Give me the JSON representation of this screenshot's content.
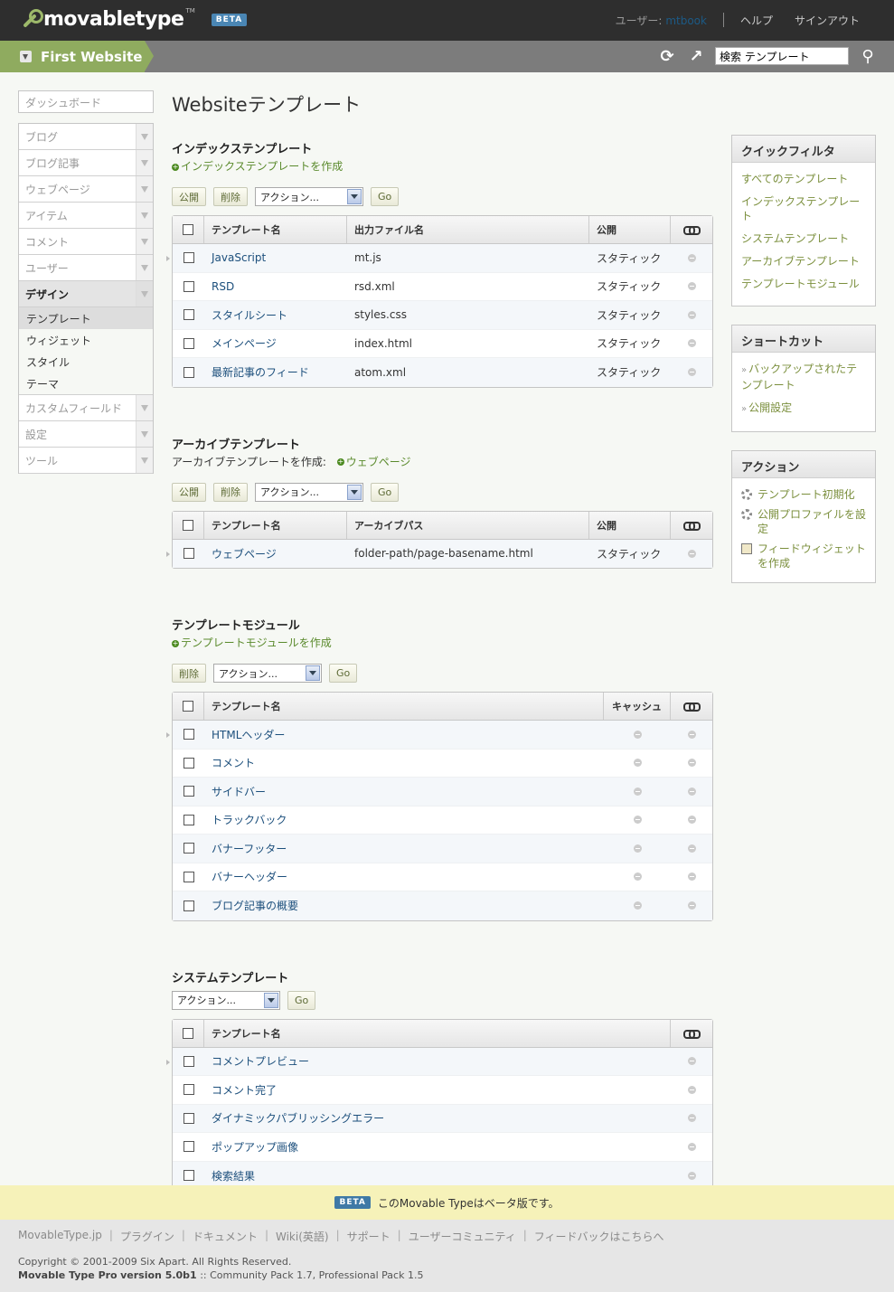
{
  "header": {
    "brand": "movabletype",
    "tm": "TM",
    "beta": "BETA",
    "user_label": "ユーザー:",
    "username": "mtbook",
    "help": "ヘルプ",
    "signout": "サインアウト"
  },
  "sitebar": {
    "site_name": "First Website",
    "search_value": "検索 テンプレート"
  },
  "leftnav": {
    "dashboard": "ダッシュボード",
    "items": [
      {
        "label": "ブログ"
      },
      {
        "label": "ブログ記事"
      },
      {
        "label": "ウェブページ"
      },
      {
        "label": "アイテム"
      },
      {
        "label": "コメント"
      },
      {
        "label": "ユーザー"
      },
      {
        "label": "デザイン"
      }
    ],
    "sub": [
      "テンプレート",
      "ウィジェット",
      "スタイル",
      "テーマ"
    ],
    "items2": [
      {
        "label": "カスタムフィールド"
      },
      {
        "label": "設定"
      },
      {
        "label": "ツール"
      }
    ]
  },
  "main": {
    "title": "Websiteテンプレート",
    "publish": "公開",
    "delete": "削除",
    "action": "アクション...",
    "go": "Go",
    "index": {
      "title": "インデックステンプレート",
      "create": "インデックステンプレートを作成",
      "cols": [
        "テンプレート名",
        "出力ファイル名",
        "公開"
      ],
      "rows": [
        {
          "name": "JavaScript",
          "file": "mt.js",
          "pub": "スタティック"
        },
        {
          "name": "RSD",
          "file": "rsd.xml",
          "pub": "スタティック"
        },
        {
          "name": "スタイルシート",
          "file": "styles.css",
          "pub": "スタティック"
        },
        {
          "name": "メインページ",
          "file": "index.html",
          "pub": "スタティック"
        },
        {
          "name": "最新記事のフィード",
          "file": "atom.xml",
          "pub": "スタティック"
        }
      ]
    },
    "archive": {
      "title": "アーカイブテンプレート",
      "note": "アーカイブテンプレートを作成:",
      "create": "ウェブページ",
      "cols": [
        "テンプレート名",
        "アーカイブパス",
        "公開"
      ],
      "rows": [
        {
          "name": "ウェブページ",
          "file": "folder-path/page-basename.html",
          "pub": "スタティック"
        }
      ]
    },
    "modules": {
      "title": "テンプレートモジュール",
      "create": "テンプレートモジュールを作成",
      "cols": [
        "テンプレート名",
        "キャッシュ"
      ],
      "rows": [
        "HTMLヘッダー",
        "コメント",
        "サイドバー",
        "トラックバック",
        "バナーフッター",
        "バナーヘッダー",
        "ブログ記事の概要"
      ]
    },
    "system": {
      "title": "システムテンプレート",
      "cols": [
        "テンプレート名"
      ],
      "rows": [
        "コメントプレビュー",
        "コメント完了",
        "ダイナミックパブリッシングエラー",
        "ポップアップ画像",
        "検索結果"
      ]
    }
  },
  "right": {
    "quick": {
      "title": "クイックフィルタ",
      "items": [
        "すべてのテンプレート",
        "インデックステンプレート",
        "システムテンプレート",
        "アーカイブテンプレート",
        "テンプレートモジュール"
      ]
    },
    "shortcut": {
      "title": "ショートカット",
      "items": [
        "バックアップされたテンプレート",
        "公開設定"
      ]
    },
    "actions": {
      "title": "アクション",
      "items": [
        "テンプレート初期化",
        "公開プロファイルを設定",
        "フィードウィジェットを作成"
      ]
    }
  },
  "footer": {
    "beta": "BETA",
    "beta_text": "このMovable Typeはベータ版です。",
    "links": [
      "MovableType.jp",
      "プラグイン",
      "ドキュメント",
      "Wiki(英語)",
      "サポート",
      "ユーザーコミュニティ",
      "フィードバックはこちらへ"
    ],
    "copyright": "Copyright © 2001-2009 Six Apart. All Rights Reserved.",
    "version_product": "Movable Type Pro",
    "version_num": "version 5.0b1",
    "version_extra": ":: Community Pack 1.7, Professional Pack 1.5"
  }
}
